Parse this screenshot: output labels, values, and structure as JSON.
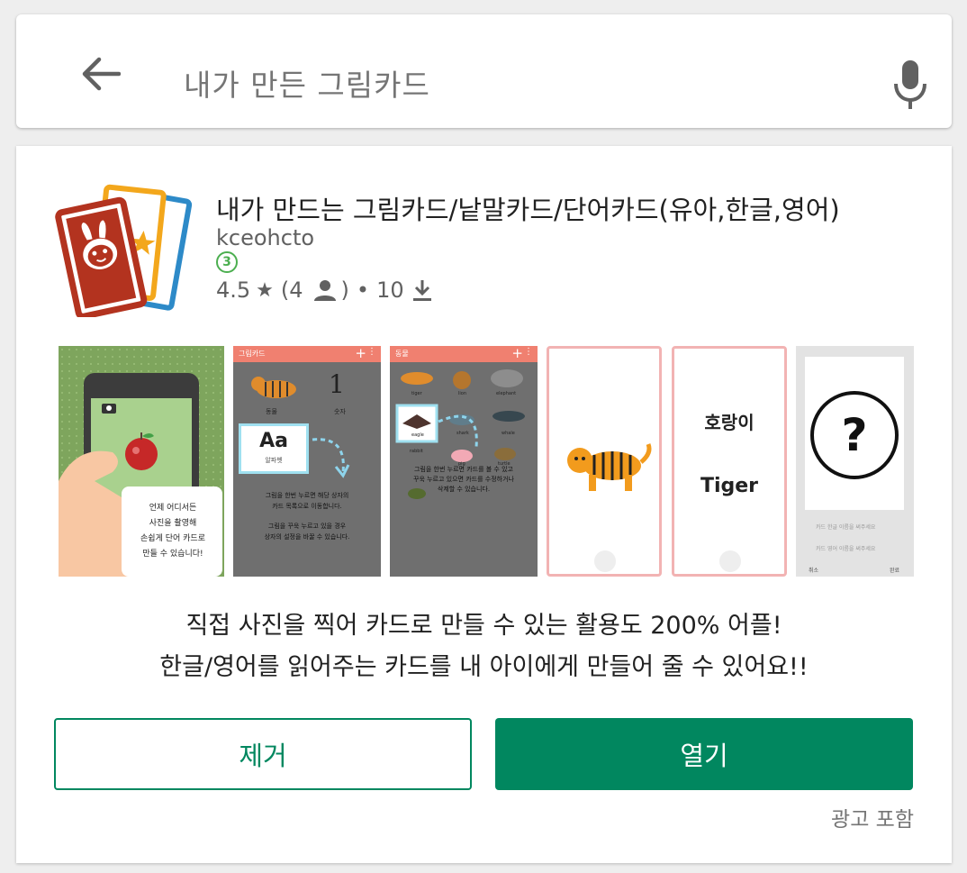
{
  "search": {
    "query": "내가 만든 그림카드"
  },
  "app": {
    "title": "내가 만드는 그림카드/낱말카드/단어카드(유아,한글,영어)",
    "developer": "kceohcto",
    "age_rating": "3",
    "rating": "4.5",
    "rating_star": "★",
    "reviews_open": "(4",
    "reviews_close": ")",
    "separator": "•",
    "downloads": "10",
    "description": [
      "직접 사진을 찍어 카드로 만들 수 있는 활용도 200% 어플!",
      "한글/영어를 읽어주는 카드를 내 아이에게 만들어 줄 수 있어요!!"
    ],
    "remove_label": "제거",
    "open_label": "열기",
    "ads_label": "광고 포함"
  },
  "screenshots": {
    "shot1_bubble": [
      "언제 어디서든",
      "사진을 촬영해",
      "손쉽게 단어 카드로",
      "만들 수 있습니다!"
    ],
    "shot2": {
      "header": "그림카드",
      "number": "1",
      "tile1": "동물",
      "tile2": "숫자",
      "letter_tile": "Aa",
      "letter_tile_label": "알파벳",
      "text1": [
        "그림을 한번 누르면 해당 상자의",
        "카드 목록으로 이동합니다."
      ],
      "text2": [
        "그림을 꾸욱 누르고 있을 경우",
        "상자의 설정을 바꿀 수 있습니다."
      ]
    },
    "shot3": {
      "header": "동물",
      "labels": [
        "tiger",
        "lion",
        "elephant",
        "eagle",
        "shark",
        "whale",
        "rabbit",
        "pig",
        "turtle"
      ],
      "text": [
        "그림을 한번 누르면 카드를 볼 수 있고",
        "꾸욱 누르고 있으면 카드를 수정하거나",
        "삭제할 수 있습니다."
      ]
    },
    "shot5": {
      "korean": "호랑이",
      "english": "Tiger"
    },
    "shot6": {
      "question": "?",
      "field1": "카드 한글 이름을 써주세요",
      "field2": "카드 영어 이름을 써주세요",
      "btn1": "취소",
      "btn2": "완료"
    }
  },
  "colors": {
    "brand_green": "#01875f",
    "age_green": "#4caf50",
    "salmon_header": "#f08070",
    "pink_border": "#f2b3b3"
  },
  "icons": {
    "back": "arrow-left-icon",
    "mic": "microphone-icon",
    "person": "person-icon",
    "download": "download-icon"
  }
}
